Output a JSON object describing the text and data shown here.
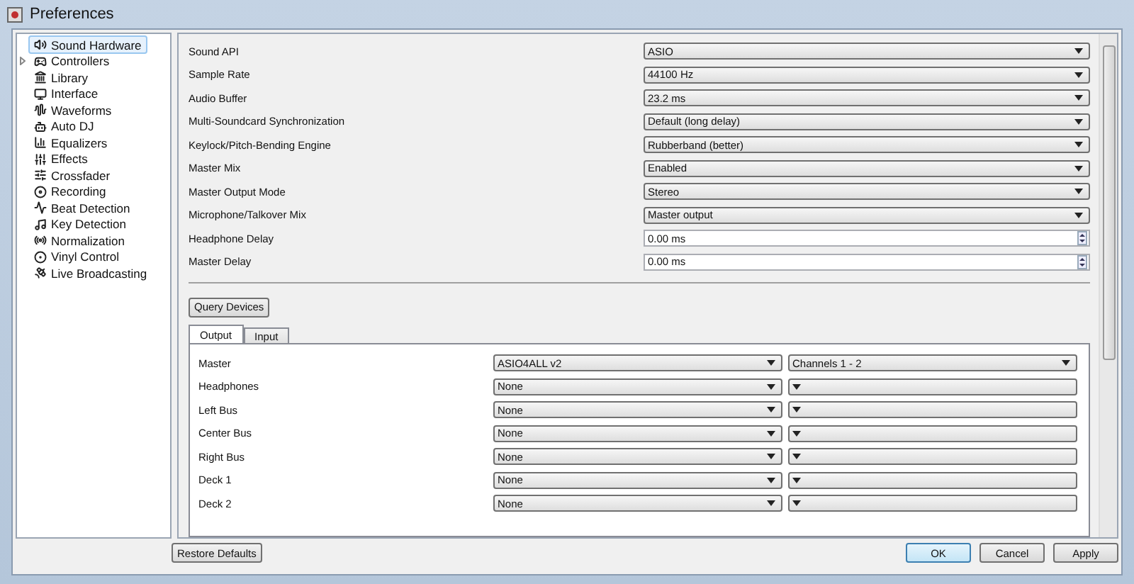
{
  "window": {
    "title": "Preferences"
  },
  "sidebar": {
    "items": [
      {
        "label": "Sound Hardware",
        "selected": true,
        "expandable": false
      },
      {
        "label": "Controllers",
        "selected": false,
        "expandable": true
      },
      {
        "label": "Library",
        "selected": false,
        "expandable": false
      },
      {
        "label": "Interface",
        "selected": false,
        "expandable": false
      },
      {
        "label": "Waveforms",
        "selected": false,
        "expandable": false
      },
      {
        "label": "Auto DJ",
        "selected": false,
        "expandable": false
      },
      {
        "label": "Equalizers",
        "selected": false,
        "expandable": false
      },
      {
        "label": "Effects",
        "selected": false,
        "expandable": false
      },
      {
        "label": "Crossfader",
        "selected": false,
        "expandable": false
      },
      {
        "label": "Recording",
        "selected": false,
        "expandable": false
      },
      {
        "label": "Beat Detection",
        "selected": false,
        "expandable": false
      },
      {
        "label": "Key Detection",
        "selected": false,
        "expandable": false
      },
      {
        "label": "Normalization",
        "selected": false,
        "expandable": false
      },
      {
        "label": "Vinyl Control",
        "selected": false,
        "expandable": false
      },
      {
        "label": "Live Broadcasting",
        "selected": false,
        "expandable": false
      }
    ]
  },
  "settings": [
    {
      "label": "Sound API",
      "kind": "select",
      "value": "ASIO"
    },
    {
      "label": "Sample Rate",
      "kind": "select",
      "value": "44100 Hz"
    },
    {
      "label": "Audio Buffer",
      "kind": "select",
      "value": "23.2 ms"
    },
    {
      "label": "Multi-Soundcard Synchronization",
      "kind": "select",
      "value": "Default (long delay)"
    },
    {
      "label": "Keylock/Pitch-Bending Engine",
      "kind": "select",
      "value": "Rubberband (better)"
    },
    {
      "label": "Master Mix",
      "kind": "select",
      "value": "Enabled"
    },
    {
      "label": "Master Output Mode",
      "kind": "select",
      "value": "Stereo"
    },
    {
      "label": "Microphone/Talkover Mix",
      "kind": "select",
      "value": "Master output"
    },
    {
      "label": "Headphone Delay",
      "kind": "spin",
      "value": "0.00 ms"
    },
    {
      "label": "Master Delay",
      "kind": "spin",
      "value": "0.00 ms"
    }
  ],
  "query_button": "Query Devices",
  "tabs": [
    {
      "label": "Output",
      "selected": true
    },
    {
      "label": "Input",
      "selected": false
    }
  ],
  "outputs": [
    {
      "label": "Master",
      "device": "ASIO4ALL v2",
      "channels": "Channels 1 - 2"
    },
    {
      "label": "Headphones",
      "device": "None"
    },
    {
      "label": "Left Bus",
      "device": "None"
    },
    {
      "label": "Center Bus",
      "device": "None"
    },
    {
      "label": "Right Bus",
      "device": "None"
    },
    {
      "label": "Deck 1",
      "device": "None"
    },
    {
      "label": "Deck 2",
      "device": "None"
    }
  ],
  "buttons": [
    {
      "label": "Restore Defaults",
      "kind": "left"
    },
    {
      "label": "OK",
      "kind": "default"
    },
    {
      "label": "Cancel",
      "kind": "normal"
    },
    {
      "label": "Apply",
      "kind": "normal"
    }
  ]
}
